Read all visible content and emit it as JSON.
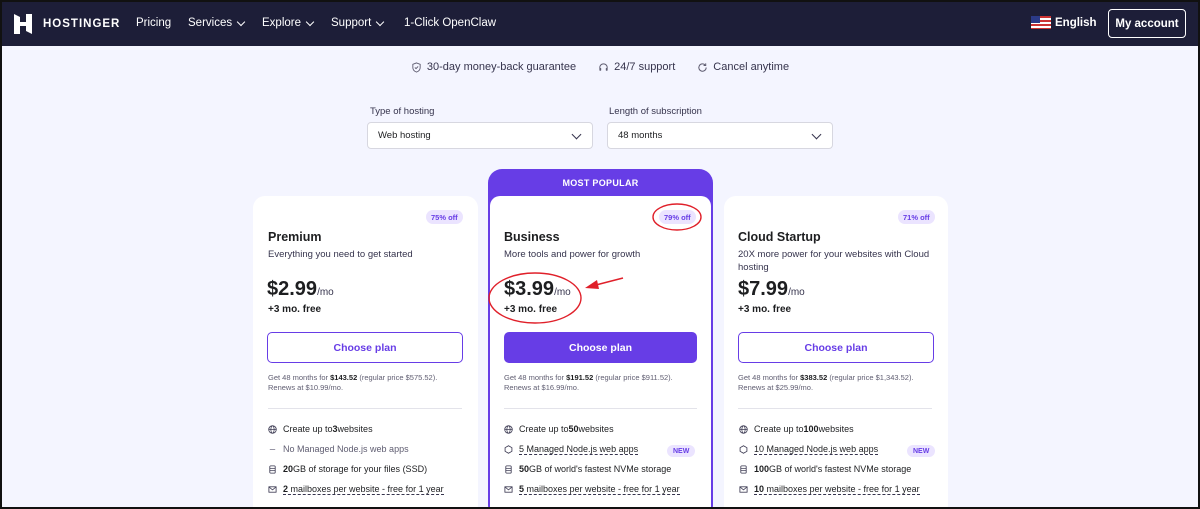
{
  "nav": {
    "logo": "HOSTINGER",
    "items": [
      {
        "label": "Pricing",
        "dropdown": false
      },
      {
        "label": "Services",
        "dropdown": true
      },
      {
        "label": "Explore",
        "dropdown": true
      },
      {
        "label": "Support",
        "dropdown": true
      },
      {
        "label": "1-Click OpenClaw",
        "dropdown": false
      }
    ],
    "language": "English",
    "account": "My account"
  },
  "perks": [
    "30-day money-back guarantee",
    "24/7 support",
    "Cancel anytime"
  ],
  "filters": {
    "hosting_label": "Type of hosting",
    "hosting_value": "Web hosting",
    "length_label": "Length of subscription",
    "length_value": "48 months"
  },
  "popular_label": "MOST POPULAR",
  "plans": [
    {
      "discount": "75% off",
      "name": "Premium",
      "desc": "Everything you need to get started",
      "price": "$2.99",
      "per": "/mo",
      "free": "+3 mo. free",
      "button": "Choose plan",
      "fine_a": "Get 48 months for ",
      "fine_total": "$143.52",
      "fine_b": " (regular price $575.52).",
      "fine_renew": "Renews at $10.99/mo.",
      "features": [
        {
          "icon": "globe-icon",
          "a": "Create up to ",
          "b": "3",
          "c": " websites"
        },
        {
          "icon": "dash-icon",
          "a": "No Managed Node.js web apps",
          "b": "",
          "c": ""
        },
        {
          "icon": "storage-icon",
          "a": "",
          "b": "20",
          "c": " GB of storage for your files (SSD)"
        },
        {
          "icon": "mail-icon",
          "a": "",
          "b": "2",
          "c": " mailboxes per website - free for 1 year"
        }
      ]
    },
    {
      "discount": "79% off",
      "name": "Business",
      "desc": "More tools and power for growth",
      "price": "$3.99",
      "per": "/mo",
      "free": "+3 mo. free",
      "button": "Choose plan",
      "fine_a": "Get 48 months for ",
      "fine_total": "$191.52",
      "fine_b": " (regular price $911.52).",
      "fine_renew": "Renews at $16.99/mo.",
      "new_badge": "NEW",
      "features": [
        {
          "icon": "globe-icon",
          "a": "Create up to ",
          "b": "50",
          "c": " websites"
        },
        {
          "icon": "nodejs-icon",
          "a": "",
          "b": "5",
          "c": " Managed Node.js web apps"
        },
        {
          "icon": "storage-icon",
          "a": "",
          "b": "50",
          "c": " GB of world's fastest NVMe storage"
        },
        {
          "icon": "mail-icon",
          "a": "",
          "b": "5",
          "c": " mailboxes per website - free for 1 year"
        }
      ]
    },
    {
      "discount": "71% off",
      "name": "Cloud Startup",
      "desc": "20X more power for your websites with Cloud hosting",
      "price": "$7.99",
      "per": "/mo",
      "free": "+3 mo. free",
      "button": "Choose plan",
      "fine_a": "Get 48 months for ",
      "fine_total": "$383.52",
      "fine_b": " (regular price $1,343.52).",
      "fine_renew": "Renews at $25.99/mo.",
      "new_badge": "NEW",
      "features": [
        {
          "icon": "globe-icon",
          "a": "Create up to ",
          "b": "100",
          "c": " websites"
        },
        {
          "icon": "nodejs-icon",
          "a": "",
          "b": "10",
          "c": " Managed Node.js web apps"
        },
        {
          "icon": "storage-icon",
          "a": "",
          "b": "100",
          "c": " GB of world's fastest NVMe storage"
        },
        {
          "icon": "mail-icon",
          "a": "",
          "b": "10",
          "c": " mailboxes per website - free for 1 year"
        }
      ]
    }
  ],
  "colors": {
    "nav_bg": "#1d1e38",
    "accent": "#673de6",
    "annotation": "#e0202a",
    "page_bg": "#f4f5ff"
  }
}
